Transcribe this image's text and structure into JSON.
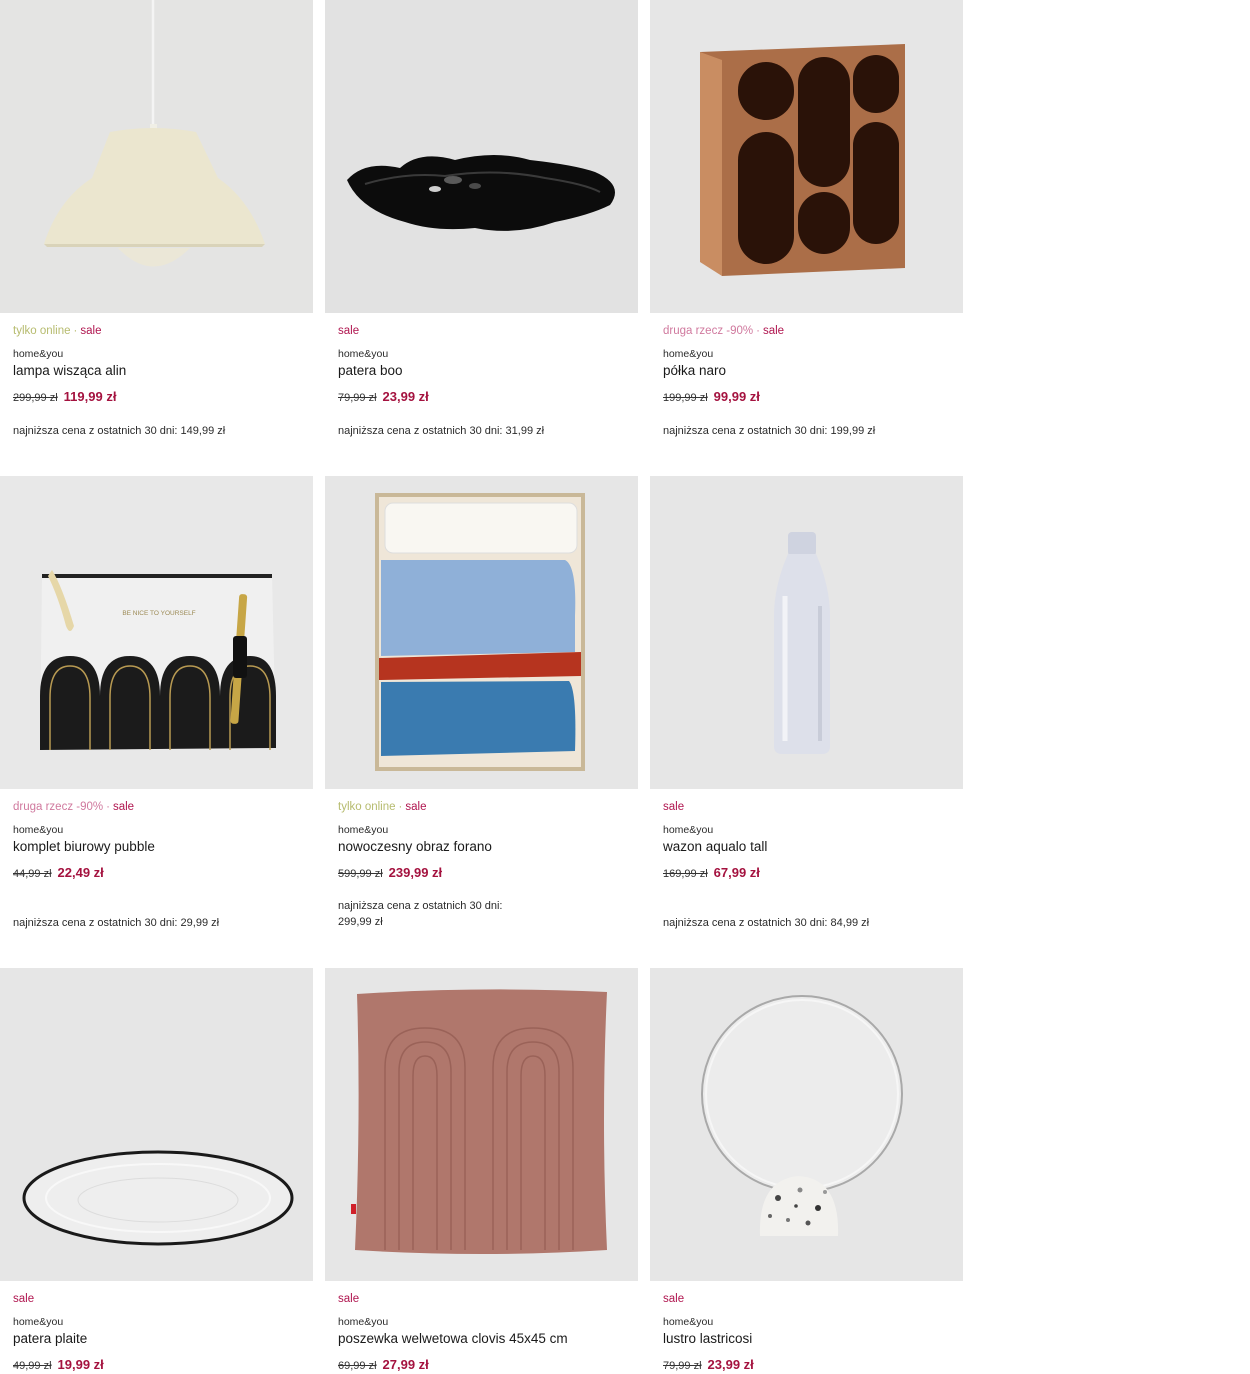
{
  "products": [
    {
      "badges": [
        "tylko online",
        "sale"
      ],
      "brand": "home&you",
      "name": "lampa wisząca alin",
      "old_price": "299,99 zł",
      "price": "119,99 zł",
      "lowest": "najniższa cena z ostatnich 30 dni: 149,99 zł"
    },
    {
      "badges": [
        "sale"
      ],
      "brand": "home&you",
      "name": "patera boo",
      "old_price": "79,99 zł",
      "price": "23,99 zł",
      "lowest": "najniższa cena z ostatnich 30 dni: 31,99 zł"
    },
    {
      "badges": [
        "druga rzecz -90%",
        "sale"
      ],
      "brand": "home&you",
      "name": "półka naro",
      "old_price": "199,99 zł",
      "price": "99,99 zł",
      "lowest": "najniższa cena z ostatnich 30 dni: 199,99 zł"
    },
    {
      "badges": [
        "druga rzecz -90%",
        "sale"
      ],
      "brand": "home&you",
      "name": "komplet biurowy pubble",
      "old_price": "44,99 zł",
      "price": "22,49 zł",
      "lowest": "najniższa cena z ostatnich 30 dni: 29,99 zł"
    },
    {
      "badges": [
        "tylko online",
        "sale"
      ],
      "brand": "home&you",
      "name": "nowoczesny obraz forano",
      "old_price": "599,99 zł",
      "price": "239,99 zł",
      "lowest": "najniższa cena z ostatnich 30 dni: 299,99 zł"
    },
    {
      "badges": [
        "sale"
      ],
      "brand": "home&you",
      "name": "wazon aqualo tall",
      "old_price": "169,99 zł",
      "price": "67,99 zł",
      "lowest": "najniższa cena z ostatnich 30 dni: 84,99 zł"
    },
    {
      "badges": [
        "sale"
      ],
      "brand": "home&you",
      "name": "patera plaite",
      "old_price": "49,99 zł",
      "price": "19,99 zł",
      "lowest": ""
    },
    {
      "badges": [
        "sale"
      ],
      "brand": "home&you",
      "name": "poszewka welwetowa clovis 45x45 cm",
      "old_price": "69,99 zł",
      "price": "27,99 zł",
      "lowest": ""
    },
    {
      "badges": [
        "sale"
      ],
      "brand": "home&you",
      "name": "lustro lastricosi",
      "old_price": "79,99 zł",
      "price": "23,99 zł",
      "lowest": ""
    }
  ],
  "print_text": "BE NICE TO YOURSELF",
  "colors": {
    "sale": "#b0154f",
    "online": "#b6bb6e",
    "second_item": "#d0799e",
    "price": "#a4123f"
  }
}
